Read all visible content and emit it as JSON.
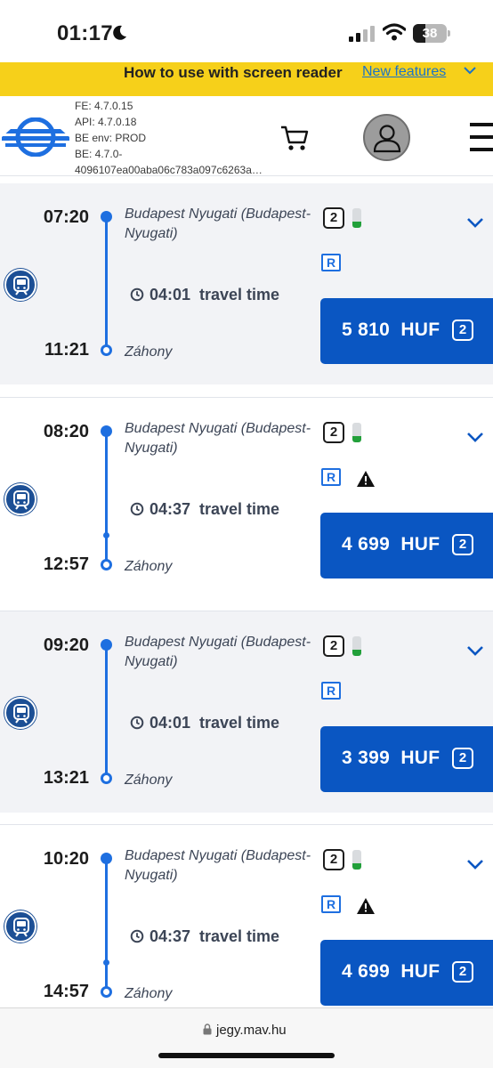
{
  "status_bar": {
    "time": "01:17",
    "battery": "38",
    "battery_level": 0.38
  },
  "banner": {
    "text": "How to use with screen reader",
    "link": "New features"
  },
  "header": {
    "version_lines": [
      "FE: 4.7.0.15",
      "API: 4.7.0.18",
      "BE env: PROD",
      "BE: 4.7.0-",
      "4096107ea00aba06c783a097c6263a…"
    ]
  },
  "journeys": [
    {
      "departure": "07:20",
      "arrival": "11:21",
      "from": "Budapest Nyugati (Budapest-Nyugati)",
      "to": "Záhony",
      "duration": "04:01",
      "duration_label": "travel time",
      "class": "2",
      "price": "5 810  HUF",
      "price_class": "2",
      "service_badge": "R",
      "warning": false,
      "transfer": false,
      "seat_load": 0.3
    },
    {
      "departure": "08:20",
      "arrival": "12:57",
      "from": "Budapest Nyugati (Budapest-Nyugati)",
      "to": "Záhony",
      "duration": "04:37",
      "duration_label": "travel time",
      "class": "2",
      "price": "4 699  HUF",
      "price_class": "2",
      "service_badge": "R",
      "warning": true,
      "transfer": true,
      "seat_load": 0.3
    },
    {
      "departure": "09:20",
      "arrival": "13:21",
      "from": "Budapest Nyugati (Budapest-Nyugati)",
      "to": "Záhony",
      "duration": "04:01",
      "duration_label": "travel time",
      "class": "2",
      "price": "3 399  HUF",
      "price_class": "2",
      "service_badge": "R",
      "warning": false,
      "transfer": false,
      "seat_load": 0.3
    },
    {
      "departure": "10:20",
      "arrival": "14:57",
      "from": "Budapest Nyugati (Budapest-Nyugati)",
      "to": "Záhony",
      "duration": "04:37",
      "duration_label": "travel time",
      "class": "2",
      "price": "4 699  HUF",
      "price_class": "2",
      "service_badge": "R",
      "warning": true,
      "transfer": true,
      "seat_load": 0.3
    }
  ],
  "browser": {
    "url": "jegy.mav.hu"
  },
  "colors": {
    "brand_blue": "#0a56c2",
    "timeline_blue": "#1e6fe0",
    "banner_yellow": "#f6d01a",
    "seat_load_green": "#22a03a"
  },
  "icons": {
    "cart": "shopping-cart-icon",
    "avatar": "user-avatar-icon",
    "menu": "hamburger-menu-icon",
    "train": "train-icon",
    "clock": "clock-icon",
    "warning": "warning-triangle-icon",
    "expand": "chevron-down-icon",
    "lock": "lock-icon"
  }
}
